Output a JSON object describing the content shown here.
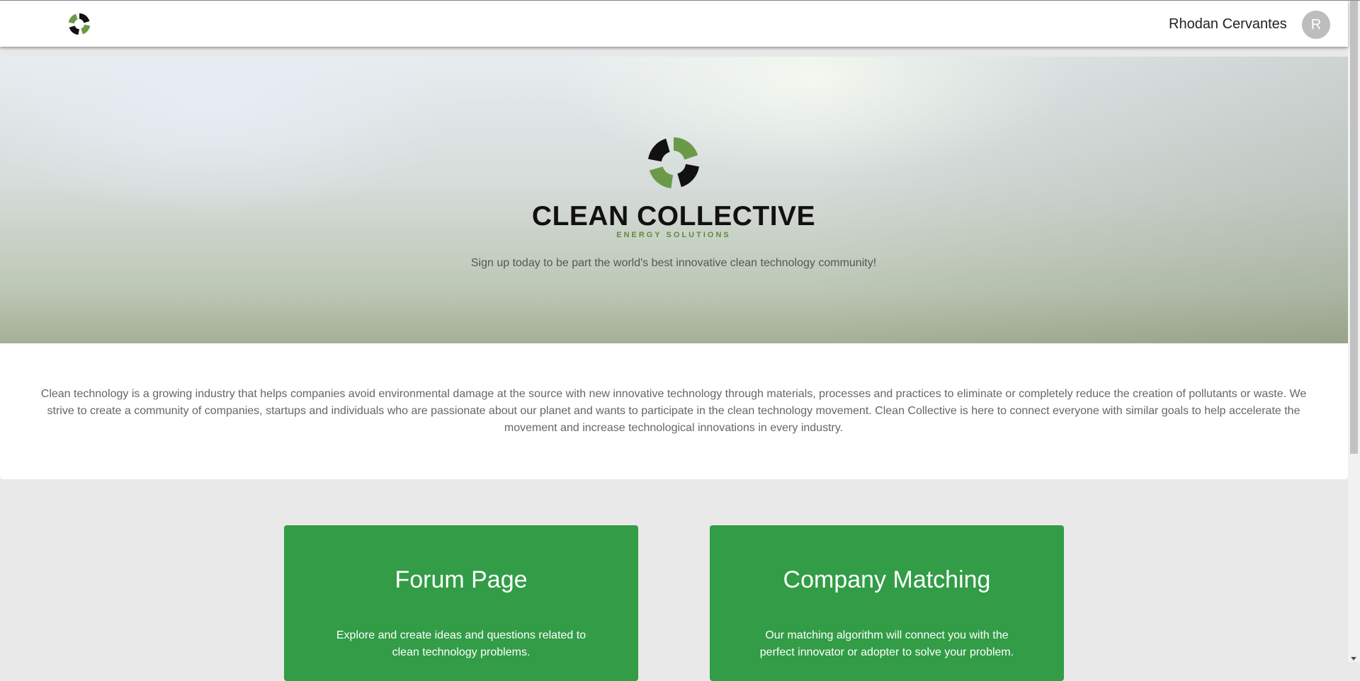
{
  "navbar": {
    "logo_icon": "clean-collective-swirl-icon",
    "user_name": "Rhodan Cervantes",
    "avatar_initial": "R"
  },
  "hero": {
    "logo_icon": "clean-collective-swirl-icon",
    "brand_title": "CLEAN COLLECTIVE",
    "brand_subtitle": "ENERGY SOLUTIONS",
    "tagline": "Sign up today to be part the world's best innovative clean technology community!"
  },
  "about": {
    "text": "Clean technology is a growing industry that helps companies avoid environmental damage at the source with new innovative technology through materials, processes and practices to eliminate or completely reduce the creation of pollutants or waste. We strive to create a community of companies, startups and individuals who are passionate about our planet and wants to participate in the clean technology movement. Clean Collective is here to connect everyone with similar goals to help accelerate the movement and increase technological innovations in every industry."
  },
  "cards": [
    {
      "title": "Forum Page",
      "description": "Explore and create ideas and questions related to clean technology problems."
    },
    {
      "title": "Company Matching",
      "description": "Our matching algorithm will connect you with the perfect innovator or adopter to solve your problem."
    }
  ],
  "colors": {
    "accent_green": "#329c46",
    "logo_green": "#6a9a48",
    "logo_black": "#111111",
    "brand_subtitle_green": "#5f8a3b"
  }
}
